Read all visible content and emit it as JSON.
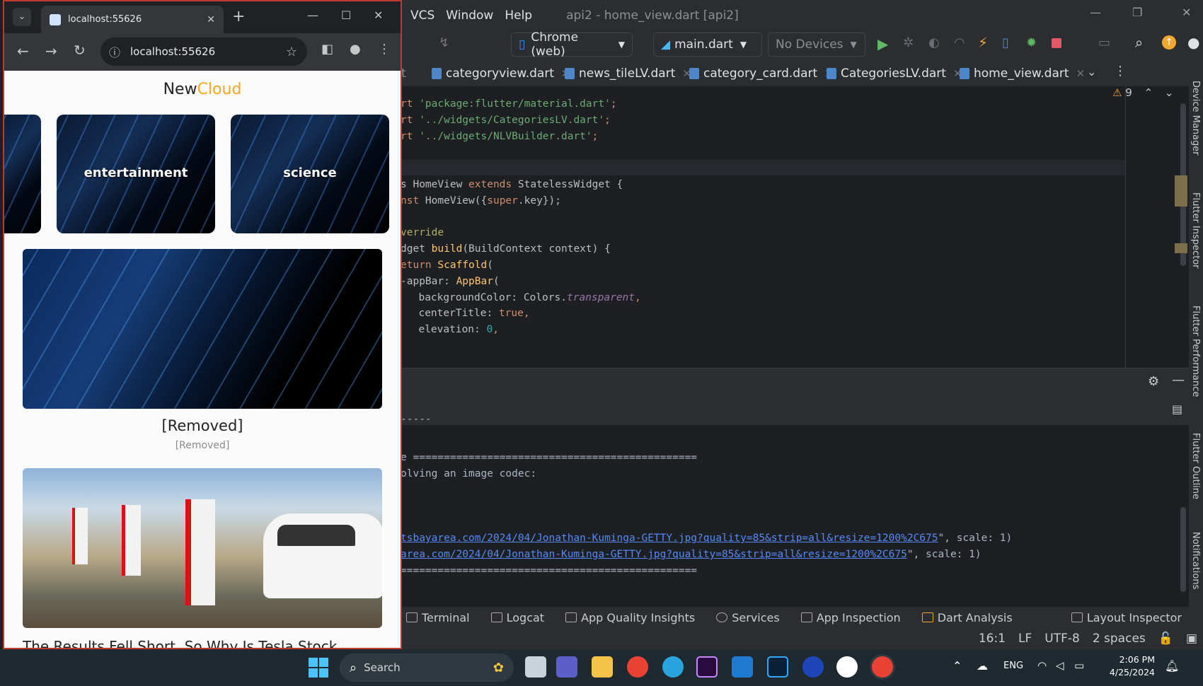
{
  "browser": {
    "tab_title": "localhost:55626",
    "url": "localhost:55626",
    "app": {
      "brand_part1": "New",
      "brand_part2": "Cloud",
      "brand_accent": "#f5a623",
      "categories": [
        "entertainment",
        "science"
      ],
      "articles": [
        {
          "title": "[Removed]",
          "subtitle": "[Removed]"
        },
        {
          "title": "The Results Fell Short. So Why Is Tesla Stock"
        }
      ]
    }
  },
  "ide": {
    "menu": [
      "VCS",
      "Window",
      "Help"
    ],
    "title": "api2 - home_view.dart [api2]",
    "toolbar": {
      "device_target": "Chrome (web)",
      "run_config": "main.dart",
      "devices": "No Devices"
    },
    "tabs": [
      {
        "label": "rt",
        "active": false
      },
      {
        "label": "categoryview.dart",
        "active": false
      },
      {
        "label": "news_tileLV.dart",
        "active": false
      },
      {
        "label": "category_card.dart",
        "active": false
      },
      {
        "label": "CategoriesLV.dart",
        "active": false
      },
      {
        "label": "home_view.dart",
        "active": true
      }
    ],
    "warnings_count": "9",
    "code": {
      "l1a": "rt ",
      "l1b": "'package:flutter/material.dart'",
      "l1c": ";",
      "l2a": "rt ",
      "l2b": "'../widgets/CategoriesLV.dart'",
      "l2c": ";",
      "l3a": "rt ",
      "l3b": "'../widgets/NLVBuilder.dart'",
      "l3c": ";",
      "l4a": "s HomeView ",
      "l4b": "extends",
      "l4c": " StatelessWidget {",
      "l5a": "nst",
      "l5b": " HomeView({",
      "l5c": "super",
      "l5d": ".key});",
      "l6": "verride",
      "l7a": "dget ",
      "l7b": "build",
      "l7c": "(BuildContext context) {",
      "l8a": "eturn ",
      "l8b": "Scaffold",
      "l8c": "(",
      "l9a": "-appBar: ",
      "l9b": "AppBar",
      "l9c": "(",
      "l10a": "  backgroundColor: Colors.",
      "l10b": "transparent",
      "l10c": ",",
      "l11a": "  centerTitle: ",
      "l11b": "true",
      "l11c": ",",
      "l12a": "  elevation: ",
      "l12b": "0",
      "l12c": ","
    },
    "log": {
      "l0": "----- ",
      "l1": "e ==============================================",
      "l2": "olving an image codec:",
      "l3_link": "tsbayarea.com/2024/04/Jonathan-Kuminga-GETTY.jpg?quality=85&strip=all&resize=1200%2C675",
      "l3_tail": "\", scale: 1)",
      "l4_link": "area.com/2024/04/Jonathan-Kuminga-GETTY.jpg?quality=85&strip=all&resize=1200%2C675",
      "l4_tail": "\", scale: 1)",
      "l5": "================================================"
    },
    "bottom_tools": [
      "Terminal",
      "Logcat",
      "App Quality Insights",
      "Services",
      "App Inspection",
      "Dart Analysis"
    ],
    "layout_inspector": "Layout Inspector",
    "status": {
      "position": "16:1",
      "line_sep": "LF",
      "encoding": "UTF-8",
      "indent": "2 spaces"
    },
    "right_strip": [
      "Device Manager",
      "Flutter Inspector",
      "Flutter Performance",
      "Flutter Outline",
      "Notifications"
    ]
  },
  "taskbar": {
    "search": "Search",
    "lang": "ENG",
    "time": "2:06 PM",
    "date": "4/25/2024"
  }
}
